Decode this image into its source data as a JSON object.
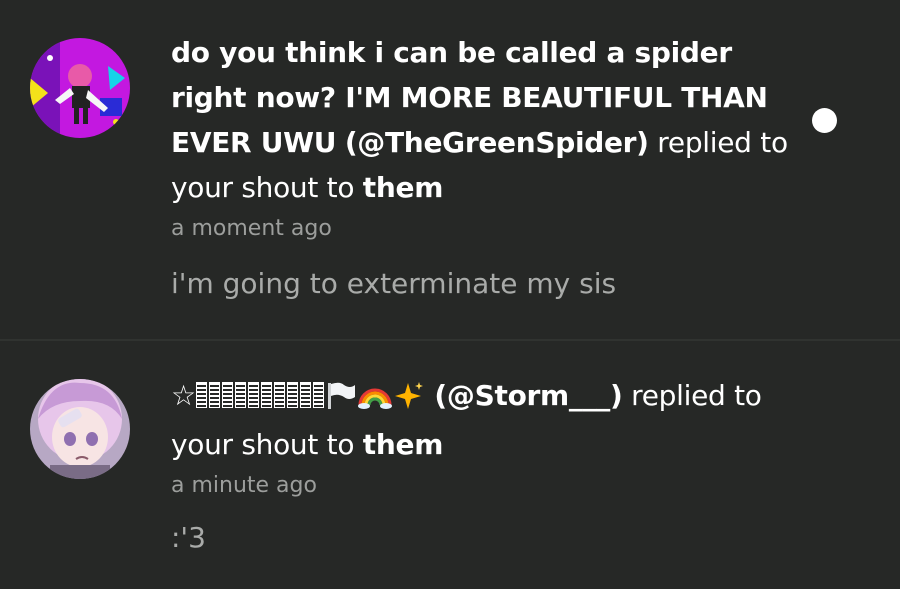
{
  "notifications": [
    {
      "display_name": "do you think i can be called a spider right now? I'M MORE BEAUTIFUL THAN EVER UWU",
      "handle": "(@TheGreenSpider)",
      "action_text": "replied",
      "context_text": "to your shout to",
      "context_target": "them",
      "time": "a moment ago",
      "message": "i'm going to exterminate my sis",
      "unread": true
    },
    {
      "display_name_prefix": "☆",
      "display_name_emojis": [
        "white-flag",
        "rainbow",
        "sparkles"
      ],
      "handle": "(@Storm___)",
      "action_text": "replied",
      "context_text": "to your shout to",
      "context_target": "them",
      "time": "a minute ago",
      "message": ":'3",
      "unread": false
    }
  ],
  "colors": {
    "background": "#262826",
    "primary_text": "#ffffff",
    "secondary_text": "#9c9e9c",
    "message_text": "#a9aba9",
    "unread_dot": "#ffffff"
  }
}
